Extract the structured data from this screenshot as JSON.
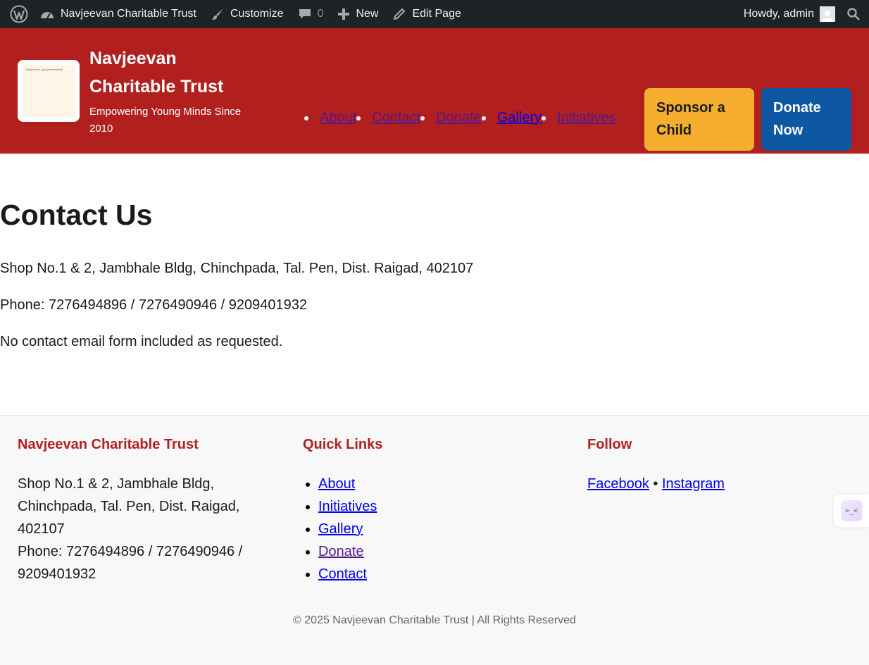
{
  "admin_bar": {
    "wp_logo_icon": "wordpress-icon",
    "site_name": "Navjeevan Charitable Trust",
    "customize": "Customize",
    "comments_count": "0",
    "new": "New",
    "edit_page": "Edit Page",
    "greeting": "Howdy, admin"
  },
  "header": {
    "logo_alt": "Navjeevan Logo (placeholder)",
    "title_line1": "Navjeevan",
    "title_line2": "Charitable Trust",
    "tagline_line1": "Empowering Young Minds Since",
    "tagline_line2": "2010",
    "nav": [
      {
        "label": "About",
        "visited": true
      },
      {
        "label": "Contact",
        "visited": true
      },
      {
        "label": "Donate",
        "visited": true
      },
      {
        "label": "Gallery",
        "visited": false
      },
      {
        "label": "Initiatives",
        "visited": true
      }
    ],
    "sponsor_line1": "Sponsor a",
    "sponsor_line2": "Child",
    "donate_line1": "Donate",
    "donate_line2": "Now"
  },
  "main": {
    "title": "Contact Us",
    "address": "Shop No.1 & 2, Jambhale Bldg, Chinchpada, Tal. Pen, Dist. Raigad, 402107",
    "phone": "Phone: 7276494896 / 7276490946 / 9209401932",
    "note": "No contact email form included as requested."
  },
  "footer": {
    "col1_heading": "Navjeevan Charitable Trust",
    "col1_line1": "Shop No.1 & 2, Jambhale Bldg,",
    "col1_line2": "Chinchpada, Tal. Pen, Dist. Raigad,",
    "col1_line3": "402107",
    "col1_line4": "Phone: 7276494896 / 7276490946 /",
    "col1_line5": "9209401932",
    "col2_heading": "Quick Links",
    "links": [
      "About",
      "Initiatives",
      "Gallery",
      "Donate",
      "Contact"
    ],
    "col3_heading": "Follow",
    "facebook": "Facebook",
    "separator": "•",
    "instagram": "Instagram",
    "copyright": "© 2025 Navjeevan Charitable Trust | All Rights Reserved"
  },
  "colors": {
    "header_red": "#b21f1f",
    "sponsor_yellow": "#f5ae2d",
    "donate_blue": "#0e58a3",
    "admin_bar_dark": "#1d2327"
  }
}
